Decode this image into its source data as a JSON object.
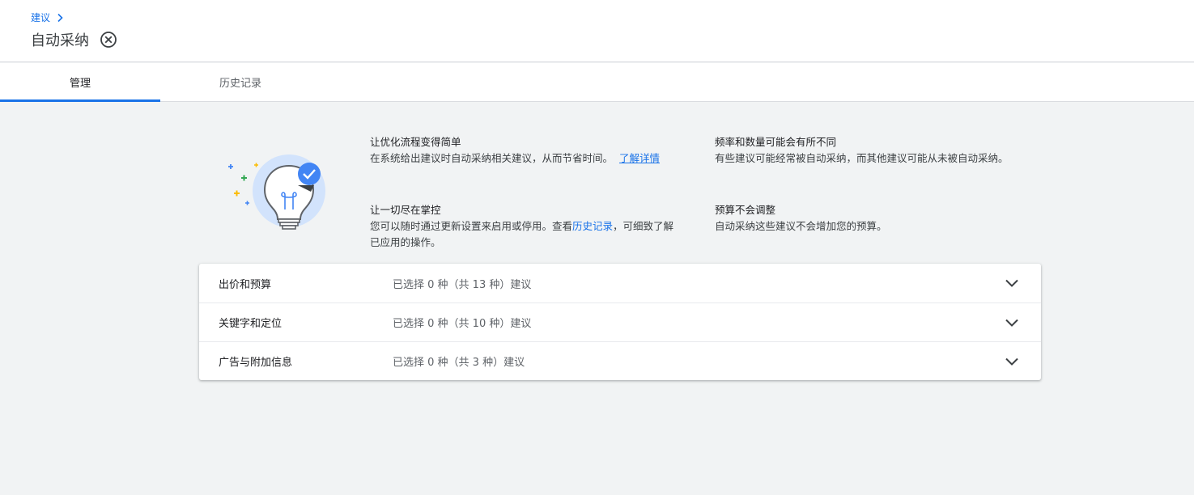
{
  "header": {
    "breadcrumb": "建议",
    "title": "自动采纳"
  },
  "tabs": [
    {
      "label": "管理",
      "active": true
    },
    {
      "label": "历史记录",
      "active": false
    }
  ],
  "info": {
    "simplify": {
      "title": "让优化流程变得简单",
      "text": "在系统给出建议时自动采纳相关建议，从而节省时间。",
      "link": "了解详情"
    },
    "control": {
      "title": "让一切尽在掌控",
      "text_before": "您可以随时通过更新设置来启用或停用。查看",
      "link": "历史记录",
      "text_after": "，可细致了解已应用的操作。"
    },
    "frequency": {
      "title": "频率和数量可能会有所不同",
      "text": "有些建议可能经常被自动采纳，而其他建议可能从未被自动采纳。"
    },
    "budget": {
      "title": "预算不会调整",
      "text": "自动采纳这些建议不会增加您的预算。"
    }
  },
  "categories": [
    {
      "label": "出价和预算",
      "summary": "已选择 0 种（共 13 种）建议"
    },
    {
      "label": "关键字和定位",
      "summary": "已选择 0 种（共 10 种）建议"
    },
    {
      "label": "广告与附加信息",
      "summary": "已选择 0 种（共 3 种）建议"
    }
  ],
  "icons": {
    "breadcrumb_chevron": "chevron-right-icon",
    "close": "close-circle-icon",
    "expand": "chevron-down-icon",
    "illustration": "lightbulb-check-icon"
  },
  "colors": {
    "accent": "#1a73e8",
    "bulb_halo": "#d2e3fc",
    "check_badge": "#4285f4",
    "sparkle_blue": "#4285f4",
    "sparkle_green": "#34a853",
    "sparkle_yellow": "#fbbc04"
  }
}
